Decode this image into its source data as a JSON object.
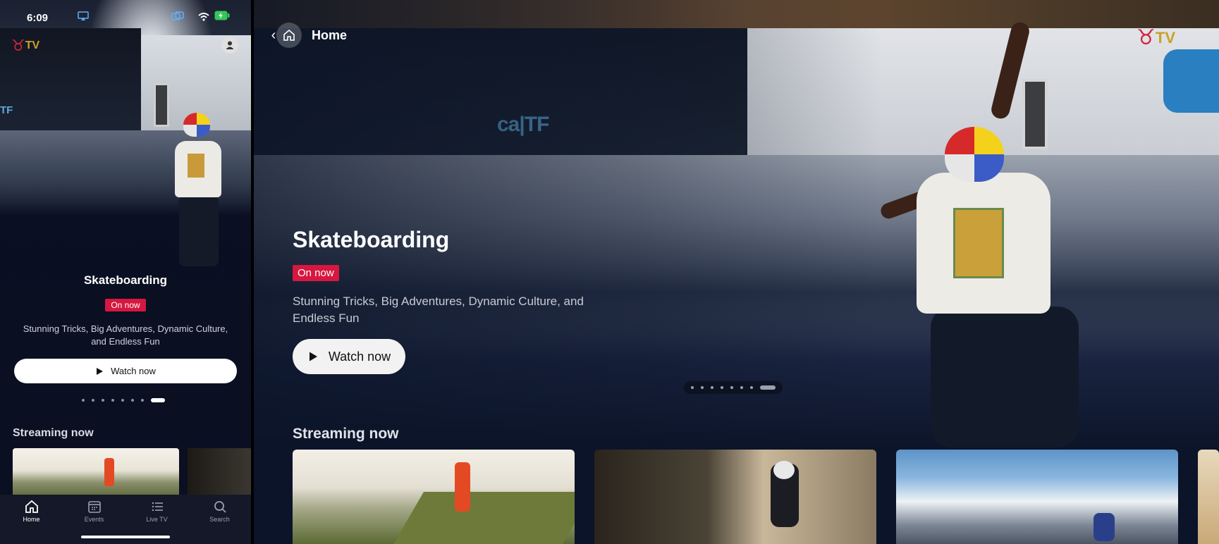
{
  "phone": {
    "status": {
      "time": "6:09"
    },
    "logo": {
      "tv": "TV"
    },
    "hero": {
      "title": "Skateboarding",
      "badge": "On now",
      "description": "Stunning Tricks, Big Adventures, Dynamic Culture, and Endless Fun",
      "watch_label": "Watch now",
      "carousel": {
        "count": 8,
        "active_index": 7
      }
    },
    "section_title": "Streaming now",
    "tabs": [
      {
        "label": "Home",
        "icon": "home-icon",
        "active": true
      },
      {
        "label": "Events",
        "icon": "calendar-icon",
        "active": false
      },
      {
        "label": "Live TV",
        "icon": "list-icon",
        "active": false
      },
      {
        "label": "Search",
        "icon": "search-icon",
        "active": false
      }
    ]
  },
  "tv": {
    "nav": {
      "back_icon": "chevron-left-icon",
      "home_icon": "home-icon",
      "home_label": "Home"
    },
    "logo": {
      "tv": "TV"
    },
    "hero": {
      "title": "Skateboarding",
      "badge": "On now",
      "description": "Stunning Tricks, Big Adventures, Dynamic Culture, and Endless Fun",
      "watch_label": "Watch now",
      "carousel": {
        "count": 8,
        "active_index": 7
      }
    },
    "section_title": "Streaming now",
    "cards": [
      "card-trail-runner",
      "card-mountain-bike",
      "card-wingsuit-mountains",
      "card-partial"
    ]
  },
  "colors": {
    "accent_badge": "#d6173f",
    "brand_red": "#d2243a",
    "brand_gold": "#c9a227",
    "background": "#0b1428"
  }
}
